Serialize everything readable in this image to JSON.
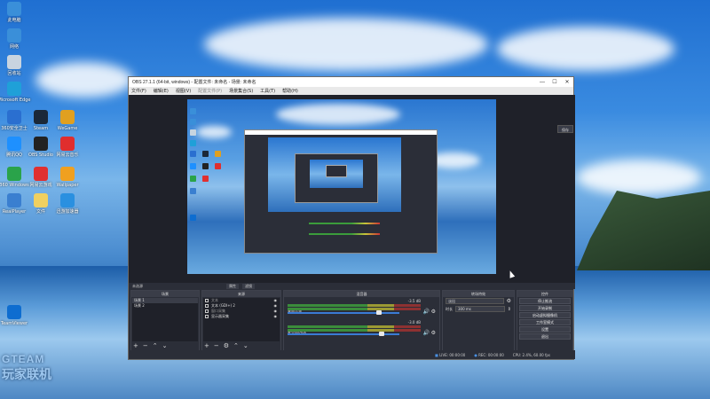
{
  "desktop": {
    "icons": [
      {
        "label": "此电脑",
        "color": "#3a8fd9"
      },
      {
        "label": "网络",
        "color": "#3a8fd9"
      },
      {
        "label": "回收站",
        "color": "#c8d4e0"
      },
      {
        "label": "Microsoft Edge",
        "color": "#1fa0d8"
      },
      {
        "label": "360安全卫士",
        "color": "#2a6fd0"
      },
      {
        "label": "Steam",
        "color": "#1b2838"
      },
      {
        "label": "WeGame",
        "color": "#e0a020"
      },
      {
        "label": "腾讯QQ",
        "color": "#1e90ff"
      },
      {
        "label": "OBS Studio",
        "color": "#222"
      },
      {
        "label": "网易云音乐",
        "color": "#e02e2e"
      },
      {
        "label": "360 Windows",
        "color": "#2aa34a"
      },
      {
        "label": "网易云游戏",
        "color": "#e03030"
      },
      {
        "label": "Wallpaper",
        "color": "#f0a020"
      },
      {
        "label": "RealPlayer",
        "color": "#3a7fd0"
      },
      {
        "label": "文件",
        "color": "#f0d060"
      },
      {
        "label": "迅游加速器",
        "color": "#2a90e0"
      },
      {
        "label": "TeamViewer",
        "color": "#0e6dd0"
      }
    ],
    "watermark": {
      "line1": "GTEAM",
      "line2": "玩家联机"
    }
  },
  "obs": {
    "title": "OBS 27.1.1 (64-bit, windows) - 配置文件: 未命名 - 场景: 未命名",
    "window_buttons": {
      "minimize": "—",
      "maximize": "☐",
      "close": "✕"
    },
    "menu": [
      {
        "label": "文件(F)",
        "disabled": false
      },
      {
        "label": "编辑(E)",
        "disabled": false
      },
      {
        "label": "视图(V)",
        "disabled": false
      },
      {
        "label": "配置文件(P)",
        "disabled": true
      },
      {
        "label": "场景集合(S)",
        "disabled": false
      },
      {
        "label": "工具(T)",
        "disabled": false
      },
      {
        "label": "帮助(H)",
        "disabled": false
      }
    ],
    "side_button": "保存",
    "toolbar": {
      "left": "未选源",
      "props": "属性",
      "filters": "滤镜"
    },
    "docks": {
      "scenes": {
        "title": "场景",
        "items": [
          "场景 1",
          "场景 2"
        ]
      },
      "sources": {
        "title": "来源",
        "items": [
          {
            "label": "文本",
            "disabled": true
          },
          {
            "label": "文本 (GDI+) 2",
            "disabled": false
          },
          {
            "label": "窗口采集",
            "disabled": true
          },
          {
            "label": "显示器采集",
            "disabled": false
          }
        ]
      },
      "mixer": {
        "title": "混音器",
        "channels": [
          {
            "name": "桌面音频",
            "db": "-3.5 dB",
            "level": 0.82
          },
          {
            "name": "麦克风/Aux",
            "db": "-3.0 dB",
            "level": 0.84
          }
        ]
      },
      "transitions": {
        "title": "转场特效",
        "type": "淡出",
        "duration_label": "时长",
        "duration": "300 ms"
      },
      "controls": {
        "title": "控件",
        "buttons": [
          "停止推流",
          "开始录制",
          "启动虚拟摄像机",
          "工作室模式",
          "设置",
          "退出"
        ]
      }
    },
    "statusbar": {
      "live": "LIVE: 00:00:00",
      "rec": "REC: 00:00:00",
      "cpu": "CPU: 2.4%, 60.00 fps"
    }
  }
}
